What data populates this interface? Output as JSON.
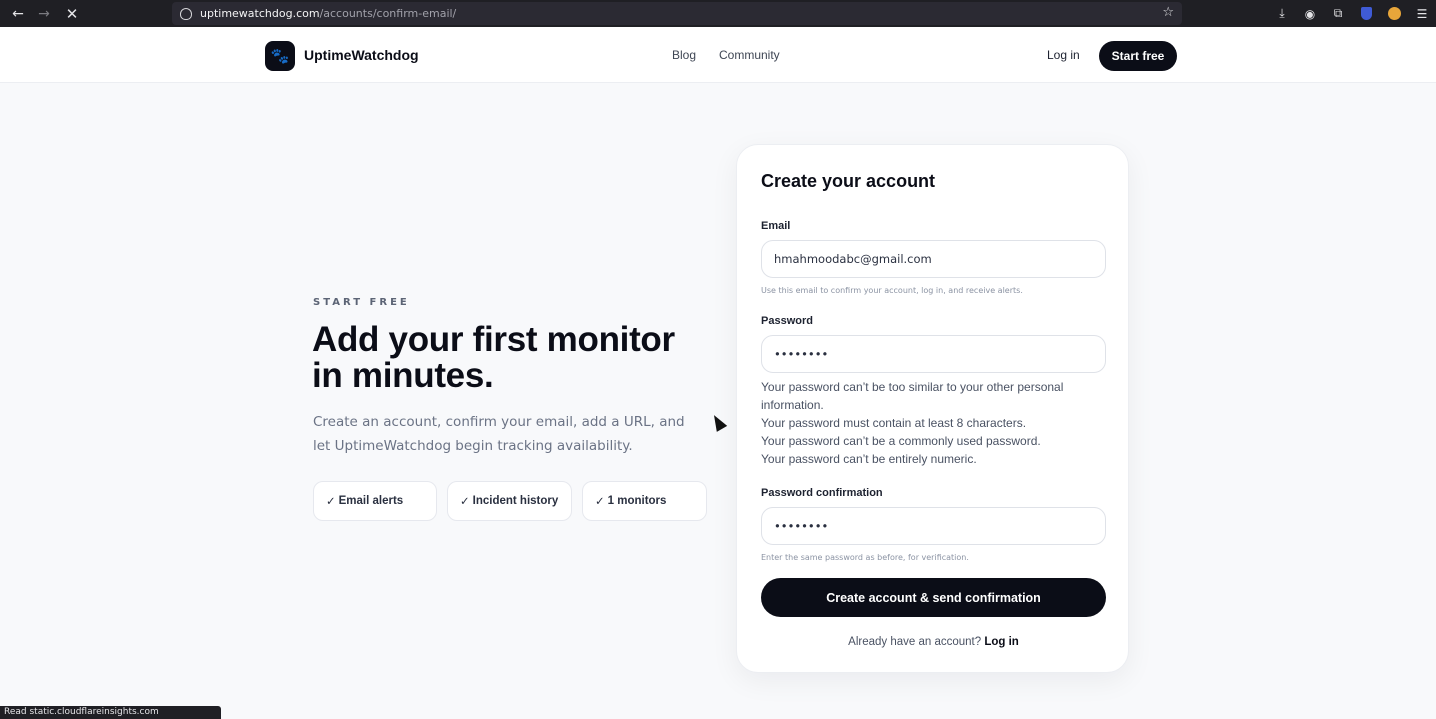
{
  "browser": {
    "url_host": "uptimewatchdog.com",
    "url_path": "/accounts/confirm-email/",
    "status_text": "Read static.cloudflareinsights.com"
  },
  "header": {
    "brand": "UptimeWatchdog",
    "nav": [
      "Blog",
      "Community"
    ],
    "login": "Log in",
    "start_free": "Start free"
  },
  "hero": {
    "eyebrow": "START FREE",
    "title": "Add your first monitor in minutes.",
    "description": "Create an account, confirm your email, add a URL, and let UptimeWatchdog begin tracking availability.",
    "check_glyph": "✓",
    "pills": [
      "Email alerts",
      "Incident history",
      "1 monitors"
    ]
  },
  "form": {
    "title": "Create your account",
    "email_label": "Email",
    "email_value": "hmahmoodabc@gmail.com",
    "email_hint": "Use this email to confirm your account, log in, and receive alerts.",
    "password_label": "Password",
    "password_value": "••••••••",
    "password_rules": [
      "Your password can’t be too similar to your other personal information.",
      "Your password must contain at least 8 characters.",
      "Your password can’t be a commonly used password.",
      "Your password can’t be entirely numeric."
    ],
    "confirm_label": "Password confirmation",
    "confirm_value": "••••••••",
    "confirm_hint": "Enter the same password as before, for verification.",
    "submit": "Create account & send confirmation",
    "already_text": "Already have an account?",
    "already_link": "Log in"
  }
}
